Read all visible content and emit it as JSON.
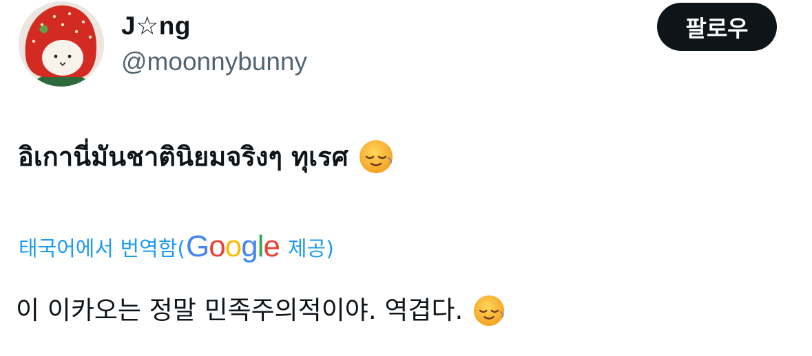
{
  "user": {
    "display_name": "J☆ng",
    "handle": "@moonnybunny",
    "avatar_icon": "strawberry-hat-doll-avatar"
  },
  "actions": {
    "follow_label": "팔로우"
  },
  "tweet": {
    "text": "อิเกานี่มันชาตินิยมจริงๆ ทุเรศ",
    "emoji": "relieved-face-emoji"
  },
  "translation": {
    "prefix": "태국어에서 번역함(",
    "google_letters": [
      {
        "char": "G",
        "color": "#4285F4"
      },
      {
        "char": "o",
        "color": "#EA4335"
      },
      {
        "char": "o",
        "color": "#FBBC05"
      },
      {
        "char": "g",
        "color": "#4285F4"
      },
      {
        "char": "l",
        "color": "#34A853"
      },
      {
        "char": "e",
        "color": "#EA4335"
      }
    ],
    "suffix": "제공)",
    "link_color": "#1d9bf0",
    "text": "이 이카오는 정말 민족주의적이야. 역겹다."
  }
}
